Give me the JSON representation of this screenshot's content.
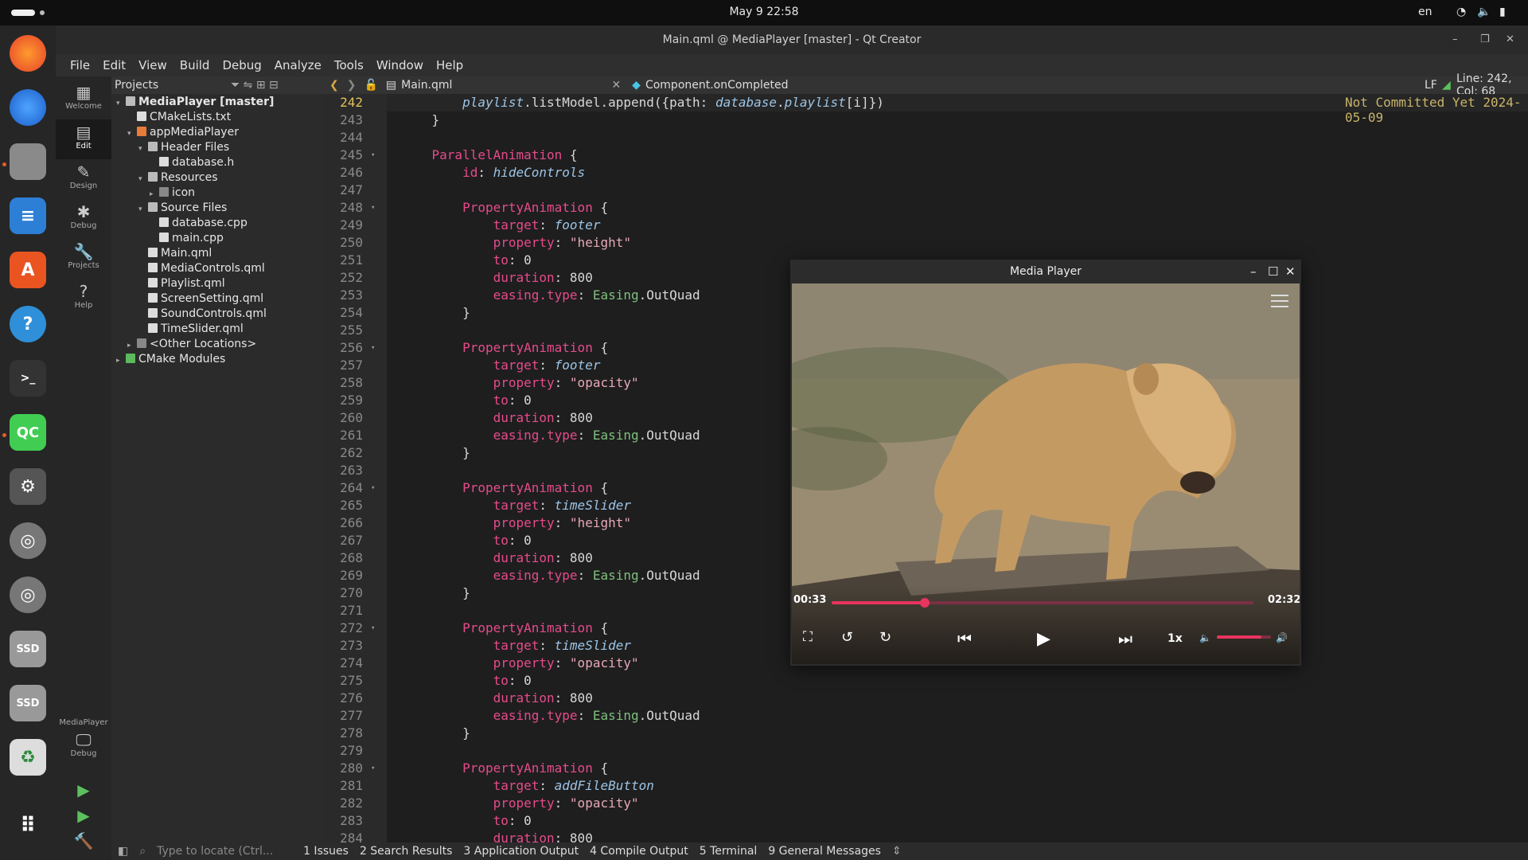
{
  "topbar": {
    "datetime": "May 9  22:58",
    "lang": "en"
  },
  "window": {
    "title": "Main.qml @ MediaPlayer [master] - Qt Creator"
  },
  "menu": [
    "File",
    "Edit",
    "View",
    "Build",
    "Debug",
    "Analyze",
    "Tools",
    "Window",
    "Help"
  ],
  "modes": {
    "welcome": "Welcome",
    "edit": "Edit",
    "design": "Design",
    "debug": "Debug",
    "projects": "Projects",
    "help": "Help",
    "kit_name": "MediaPlayer",
    "kit_mode": "Debug"
  },
  "projects": {
    "header": "Projects",
    "tree": [
      {
        "label": "MediaPlayer [master]",
        "bold": true
      },
      {
        "label": "CMakeLists.txt"
      },
      {
        "label": "appMediaPlayer"
      },
      {
        "label": "Header Files"
      },
      {
        "label": "database.h"
      },
      {
        "label": "Resources"
      },
      {
        "label": "icon"
      },
      {
        "label": "Source Files"
      },
      {
        "label": "database.cpp"
      },
      {
        "label": "main.cpp"
      },
      {
        "label": "Main.qml"
      },
      {
        "label": "MediaControls.qml"
      },
      {
        "label": "Playlist.qml"
      },
      {
        "label": "ScreenSetting.qml"
      },
      {
        "label": "SoundControls.qml"
      },
      {
        "label": "TimeSlider.qml"
      },
      {
        "label": "<Other Locations>"
      },
      {
        "label": "CMake Modules"
      }
    ]
  },
  "editor": {
    "file": "Main.qml",
    "symbol": "Component.onCompleted",
    "line_ending": "LF",
    "position": "Line: 242, Col: 68",
    "blame": "Not Committed Yet 2024-05-09",
    "lines": [
      {
        "n": "242",
        "t": "        playlist.listModel.append({path: database.playlist[i]})"
      },
      {
        "n": "243",
        "t": "    }"
      },
      {
        "n": "244",
        "t": ""
      },
      {
        "n": "245",
        "t": "    ParallelAnimation {"
      },
      {
        "n": "246",
        "t": "        id: hideControls"
      },
      {
        "n": "247",
        "t": ""
      },
      {
        "n": "248",
        "t": "        PropertyAnimation {"
      },
      {
        "n": "249",
        "t": "            target: footer"
      },
      {
        "n": "250",
        "t": "            property: \"height\""
      },
      {
        "n": "251",
        "t": "            to: 0"
      },
      {
        "n": "252",
        "t": "            duration: 800"
      },
      {
        "n": "253",
        "t": "            easing.type: Easing.OutQuad"
      },
      {
        "n": "254",
        "t": "        }"
      },
      {
        "n": "255",
        "t": ""
      },
      {
        "n": "256",
        "t": "        PropertyAnimation {"
      },
      {
        "n": "257",
        "t": "            target: footer"
      },
      {
        "n": "258",
        "t": "            property: \"opacity\""
      },
      {
        "n": "259",
        "t": "            to: 0"
      },
      {
        "n": "260",
        "t": "            duration: 800"
      },
      {
        "n": "261",
        "t": "            easing.type: Easing.OutQuad"
      },
      {
        "n": "262",
        "t": "        }"
      },
      {
        "n": "263",
        "t": ""
      },
      {
        "n": "264",
        "t": "        PropertyAnimation {"
      },
      {
        "n": "265",
        "t": "            target: timeSlider"
      },
      {
        "n": "266",
        "t": "            property: \"height\""
      },
      {
        "n": "267",
        "t": "            to: 0"
      },
      {
        "n": "268",
        "t": "            duration: 800"
      },
      {
        "n": "269",
        "t": "            easing.type: Easing.OutQuad"
      },
      {
        "n": "270",
        "t": "        }"
      },
      {
        "n": "271",
        "t": ""
      },
      {
        "n": "272",
        "t": "        PropertyAnimation {"
      },
      {
        "n": "273",
        "t": "            target: timeSlider"
      },
      {
        "n": "274",
        "t": "            property: \"opacity\""
      },
      {
        "n": "275",
        "t": "            to: 0"
      },
      {
        "n": "276",
        "t": "            duration: 800"
      },
      {
        "n": "277",
        "t": "            easing.type: Easing.OutQuad"
      },
      {
        "n": "278",
        "t": "        }"
      },
      {
        "n": "279",
        "t": ""
      },
      {
        "n": "280",
        "t": "        PropertyAnimation {"
      },
      {
        "n": "281",
        "t": "            target: addFileButton"
      },
      {
        "n": "282",
        "t": "            property: \"opacity\""
      },
      {
        "n": "283",
        "t": "            to: 0"
      },
      {
        "n": "284",
        "t": "            duration: 800"
      }
    ]
  },
  "bottom": {
    "locate_placeholder": "Type to locate (Ctrl...",
    "tabs": [
      "1  Issues",
      "2  Search Results",
      "3  Application Output",
      "4  Compile Output",
      "5  Terminal",
      "9  General Messages"
    ]
  },
  "mediaplayer": {
    "title": "Media Player",
    "current_time": "00:33",
    "total_time": "02:32",
    "progress": 0.22,
    "speed": "1x",
    "volume": 0.82
  },
  "colors": {
    "accent": "#e8345f",
    "keyword": "#e64b8b",
    "string": "#e8a8b8",
    "identifier": "#9cc4e6",
    "type": "#7fc07f"
  }
}
